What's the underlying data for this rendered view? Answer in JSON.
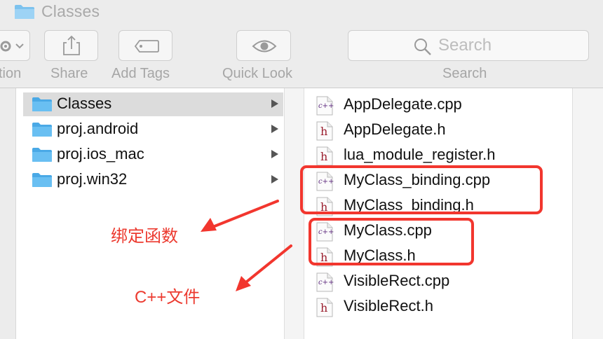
{
  "window": {
    "title": "Classes"
  },
  "toolbar": {
    "action_label": "tion",
    "share_label": "Share",
    "add_tags_label": "Add Tags",
    "quick_look_label": "Quick Look",
    "search_label": "Search",
    "search_placeholder": "Search"
  },
  "sidebar_folders": [
    {
      "name": "Classes",
      "selected": true
    },
    {
      "name": "proj.android",
      "selected": false
    },
    {
      "name": "proj.ios_mac",
      "selected": false
    },
    {
      "name": "proj.win32",
      "selected": false
    }
  ],
  "files": [
    {
      "name": "AppDelegate.cpp",
      "type": "cpp",
      "type_glyph": "c++"
    },
    {
      "name": "AppDelegate.h",
      "type": "h",
      "type_glyph": "h"
    },
    {
      "name": "lua_module_register.h",
      "type": "h",
      "type_glyph": "h"
    },
    {
      "name": "MyClass_binding.cpp",
      "type": "cpp",
      "type_glyph": "c++"
    },
    {
      "name": "MyClass_binding.h",
      "type": "h",
      "type_glyph": "h"
    },
    {
      "name": "MyClass.cpp",
      "type": "cpp",
      "type_glyph": "c++"
    },
    {
      "name": "MyClass.h",
      "type": "h",
      "type_glyph": "h"
    },
    {
      "name": "VisibleRect.cpp",
      "type": "cpp",
      "type_glyph": "c++"
    },
    {
      "name": "VisibleRect.h",
      "type": "h",
      "type_glyph": "h"
    }
  ],
  "annotations": {
    "binding_label": "绑定函数",
    "cpp_files_label": "C++文件",
    "color": "#f2362e"
  },
  "colors": {
    "folder_blue": "#5fb7ee",
    "selected_row": "#dcdcdc",
    "cpp_tag": "#5e2a7e",
    "h_tag": "#9b1f2f"
  }
}
